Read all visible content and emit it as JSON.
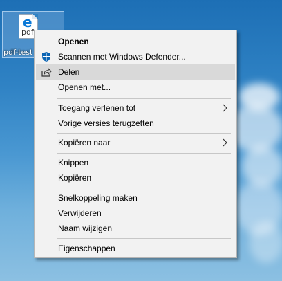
{
  "desktop": {
    "icon": {
      "label": "pdf-test",
      "badge": "pdf",
      "glyph": "e"
    }
  },
  "context_menu": {
    "items": [
      {
        "label": "Openen",
        "bold": true
      },
      {
        "label": "Scannen met Windows Defender...",
        "icon": "windows-defender-icon"
      },
      {
        "label": "Delen",
        "icon": "share-icon",
        "highlighted": true
      },
      {
        "label": "Openen met..."
      },
      {
        "label": "Toegang verlenen tot",
        "submenu": true
      },
      {
        "label": "Vorige versies terugzetten"
      },
      {
        "label": "Kopiëren naar",
        "submenu": true
      },
      {
        "label": "Knippen"
      },
      {
        "label": "Kopiëren"
      },
      {
        "label": "Snelkoppeling maken"
      },
      {
        "label": "Verwijderen"
      },
      {
        "label": "Naam wijzigen"
      },
      {
        "label": "Eigenschappen"
      }
    ]
  },
  "colors": {
    "menu_background": "#f2f2f2",
    "highlight": "#d9d9d9",
    "defender_blue": "#0a64b4"
  }
}
